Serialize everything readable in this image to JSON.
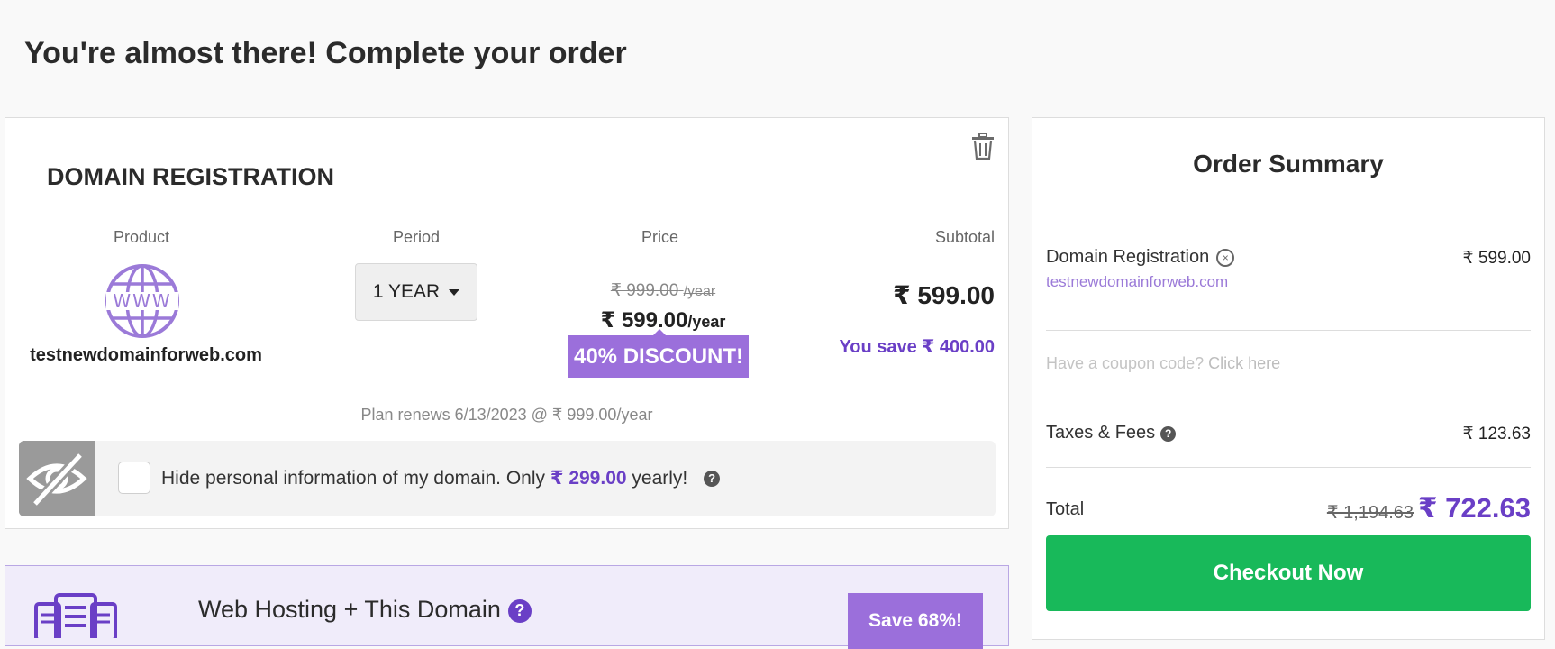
{
  "page": {
    "title": "You're almost there! Complete your order"
  },
  "domain_card": {
    "title": "DOMAIN REGISTRATION",
    "columns": {
      "product": "Product",
      "period": "Period",
      "price": "Price",
      "subtotal": "Subtotal"
    },
    "icon_text": "WWW",
    "domain": "testnewdomainforweb.com",
    "period_value": "1 YEAR",
    "old_price": "₹ 999.00",
    "old_price_unit": "/year",
    "new_price": "₹ 599.00",
    "new_price_unit": "/year",
    "discount": "40% DISCOUNT!",
    "subtotal": "₹ 599.00",
    "you_save": "You save ₹ 400.00",
    "renews": "Plan renews 6/13/2023 @ ₹ 999.00/year",
    "privacy": {
      "text_before": "Hide personal information of my domain. Only",
      "price": "₹ 299.00",
      "text_after": "yearly!",
      "checked": false
    }
  },
  "hosting_card": {
    "title": "Web Hosting + This Domain",
    "badge": "Save 68%!"
  },
  "summary": {
    "title": "Order Summary",
    "item_label": "Domain Registration",
    "item_value": "₹ 599.00",
    "item_domain": "testnewdomainforweb.com",
    "coupon_text": "Have a coupon code?",
    "coupon_link": "Click here",
    "taxes_label": "Taxes & Fees",
    "taxes_value": "₹ 123.63",
    "total_label": "Total",
    "total_old": "₹ 1,194.63",
    "total_new": "₹ 722.63",
    "checkout_label": "Checkout Now"
  },
  "colors": {
    "accent_purple": "#6a3fc6",
    "badge_purple": "#9b6fdb",
    "checkout_green": "#18b95a"
  },
  "icons": [
    "trash-icon",
    "globe-www-icon",
    "hidden-eye-icon",
    "help-icon",
    "remove-circle-icon",
    "hosting-icon"
  ]
}
